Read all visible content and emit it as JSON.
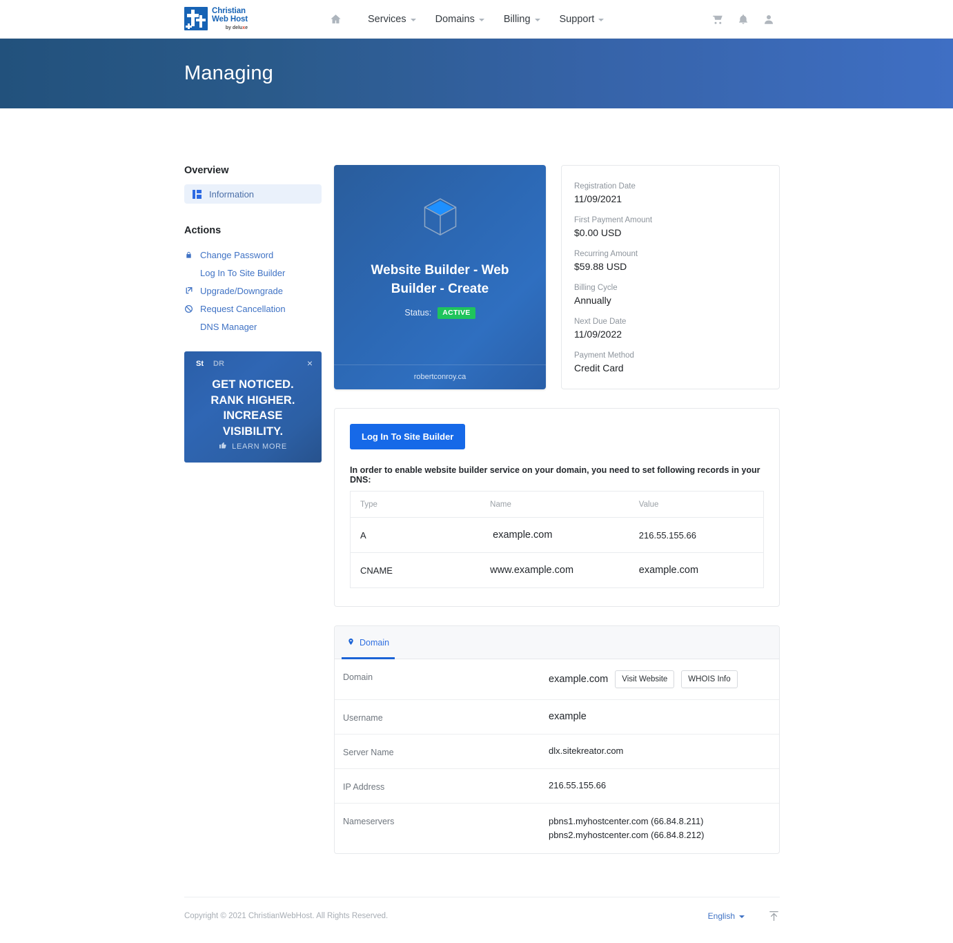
{
  "brand": {
    "line1": "Christian",
    "line2": "Web Host",
    "tagline_pre": "by delu",
    "tagline_dot": "x",
    "tagline_post": "e"
  },
  "nav": {
    "home_icon": "home-icon",
    "items": [
      {
        "label": "Services",
        "has_caret": true
      },
      {
        "label": "Domains",
        "has_caret": true
      },
      {
        "label": "Billing",
        "has_caret": true
      },
      {
        "label": "Support",
        "has_caret": true
      }
    ],
    "icons": [
      "cart-icon",
      "bell-icon",
      "user-icon"
    ]
  },
  "page": {
    "title": "Managing"
  },
  "sidebar": {
    "overview_heading": "Overview",
    "overview_items": [
      {
        "label": "Information",
        "icon": "dashboard-icon",
        "active": true
      }
    ],
    "actions_heading": "Actions",
    "actions": [
      {
        "label": "Change Password",
        "icon": "lock-icon"
      },
      {
        "label": "Log In To Site Builder",
        "icon": ""
      },
      {
        "label": "Upgrade/Downgrade",
        "icon": "external-link-icon"
      },
      {
        "label": "Request Cancellation",
        "icon": "ban-icon"
      },
      {
        "label": "DNS Manager",
        "icon": ""
      }
    ]
  },
  "promo": {
    "tab_active": "St",
    "tab_inactive": "DR",
    "close": "×",
    "headline": "GET NOTICED. RANK HIGHER. INCREASE VISIBILITY.",
    "cta_label": "LEARN MORE",
    "cta_icon": "thumbs-up-icon"
  },
  "product": {
    "icon": "cube-icon",
    "title": "Website Builder - Web Builder - Create",
    "status_label": "Status:",
    "status_value": "ACTIVE",
    "status_color": "#1fc45c",
    "domain": "robertconroy.ca"
  },
  "details": [
    {
      "label": "Registration Date",
      "value": "11/09/2021"
    },
    {
      "label": "First Payment Amount",
      "value": "$0.00 USD"
    },
    {
      "label": "Recurring Amount",
      "value": "$59.88 USD"
    },
    {
      "label": "Billing Cycle",
      "value": "Annually"
    },
    {
      "label": "Next Due Date",
      "value": "11/09/2022"
    },
    {
      "label": "Payment Method",
      "value": "Credit Card"
    }
  ],
  "dns": {
    "login_button": "Log In To Site Builder",
    "note": "In order to enable website builder service on your domain, you need to set following records in your DNS:",
    "columns": [
      "Type",
      "Name",
      "Value"
    ],
    "rows": [
      {
        "type": "A",
        "name": "example.com",
        "value": "216.55.155.66"
      },
      {
        "type": "CNAME",
        "name": "www.example.com",
        "value": "example.com"
      }
    ]
  },
  "domain_panel": {
    "tab_label": "Domain",
    "tab_icon": "location-pin-icon",
    "rows": [
      {
        "label": "Domain",
        "value": "example.com",
        "buttons": [
          "Visit Website",
          "WHOIS Info"
        ]
      },
      {
        "label": "Username",
        "value": "example"
      },
      {
        "label": "Server Name",
        "value": "dlx.sitekreator.com"
      },
      {
        "label": "IP Address",
        "value": "216.55.155.66"
      },
      {
        "label": "Nameservers",
        "value_lines": [
          "pbns1.myhostcenter.com (66.84.8.211)",
          "pbns2.myhostcenter.com (66.84.8.212)"
        ]
      }
    ]
  },
  "footer": {
    "copyright": "Copyright © 2021 ChristianWebHost. All Rights Reserved.",
    "language": "English",
    "to_top_icon": "scroll-to-top-icon"
  }
}
